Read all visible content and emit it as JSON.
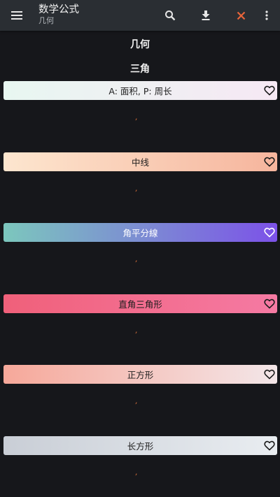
{
  "app": {
    "title": "数学公式",
    "subtitle": "几何"
  },
  "toolbar": {
    "menu_icon": "hamburger-menu-icon",
    "search_icon": "search-icon",
    "download_icon": "download-icon",
    "close_icon": "close-icon",
    "more_icon": "more-vert-icon"
  },
  "content": {
    "section_title": "几何",
    "subsection_title": "三角",
    "cards": [
      {
        "label": "A: 面积, P: 周长",
        "gradient": [
          "#e8f7f1",
          "#f6e8f4"
        ],
        "light_text": false,
        "formula": ","
      },
      {
        "label": "中线",
        "gradient": [
          "#fde6cf",
          "#f6b59d"
        ],
        "light_text": false,
        "formula": ","
      },
      {
        "label": "角平分線",
        "gradient": [
          "#7cc7bd",
          "#7c52e8"
        ],
        "light_text": true,
        "formula": ","
      },
      {
        "label": "直角三角形",
        "gradient": [
          "#f0607a",
          "#f57aa3"
        ],
        "light_text": false,
        "formula": ","
      },
      {
        "label": "正方形",
        "gradient": [
          "#f6a89a",
          "#f3e6e8"
        ],
        "light_text": false,
        "formula": ","
      },
      {
        "label": "长方形",
        "gradient": [
          "#c9ced6",
          "#e9edf1"
        ],
        "light_text": false,
        "formula": ","
      }
    ]
  },
  "colors": {
    "background": "#16171b",
    "app_bar": "#2a2e33",
    "close_accent": "#e8643a",
    "formula_accent": "#e0733a"
  }
}
